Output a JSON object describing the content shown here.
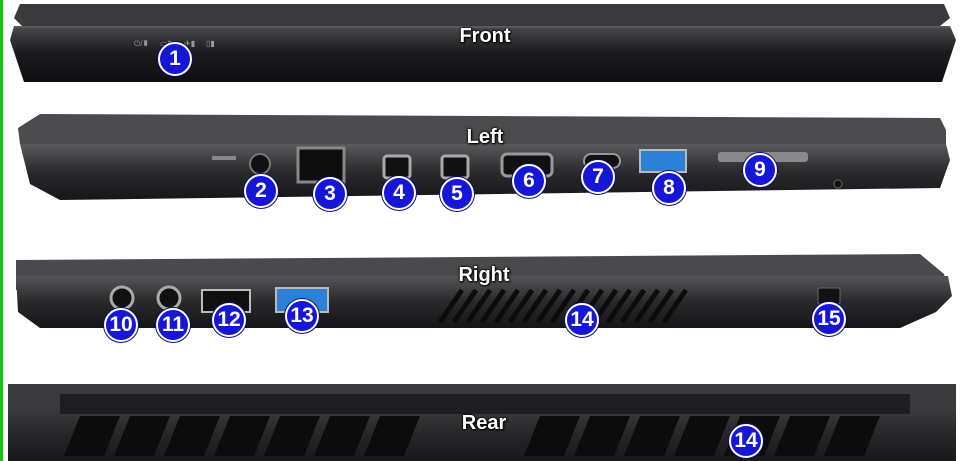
{
  "views": {
    "front": "Front",
    "left": "Left",
    "right": "Right",
    "rear": "Rear"
  },
  "callouts": [
    "1",
    "2",
    "3",
    "4",
    "5",
    "6",
    "7",
    "8",
    "9",
    "10",
    "11",
    "12",
    "13",
    "14",
    "15",
    "14"
  ],
  "colors": {
    "callout": "#1616d6",
    "body": "#2b2b2d",
    "port_blue": "#2e7fd6",
    "edge_accent": "#14c314"
  }
}
